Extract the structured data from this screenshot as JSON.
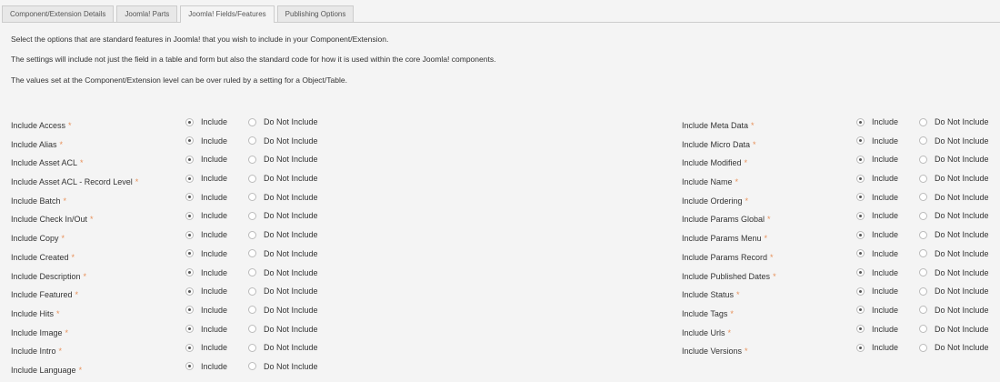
{
  "tabs": [
    "Component/Extension Details",
    "Joomla! Parts",
    "Joomla! Fields/Features",
    "Publishing Options"
  ],
  "active_tab": 2,
  "intro": [
    "Select the options that are standard features in Joomla! that you wish to include in your Component/Extension.",
    "The settings will include not just the field in a table and form but also the standard code for how it is used within the core Joomla! components.",
    "The values set at the Component/Extension level can be over ruled by a setting for a Object/Table."
  ],
  "option_labels": {
    "include": "Include",
    "exclude": "Do Not Include"
  },
  "required_marker": "*",
  "left": [
    "Include Access",
    "Include Alias",
    "Include Asset ACL",
    "Include Asset ACL - Record Level",
    "Include Batch",
    "Include Check In/Out",
    "Include Copy",
    "Include Created",
    "Include Description",
    "Include Featured",
    "Include Hits",
    "Include Image",
    "Include Intro",
    "Include Language"
  ],
  "right": [
    "Include Meta Data",
    "Include Micro Data",
    "Include Modified",
    "Include Name",
    "Include Ordering",
    "Include Params Global",
    "Include Params Menu",
    "Include Params Record",
    "Include Published Dates",
    "Include Status",
    "Include Tags",
    "Include Urls",
    "Include Versions"
  ],
  "selected": "include"
}
